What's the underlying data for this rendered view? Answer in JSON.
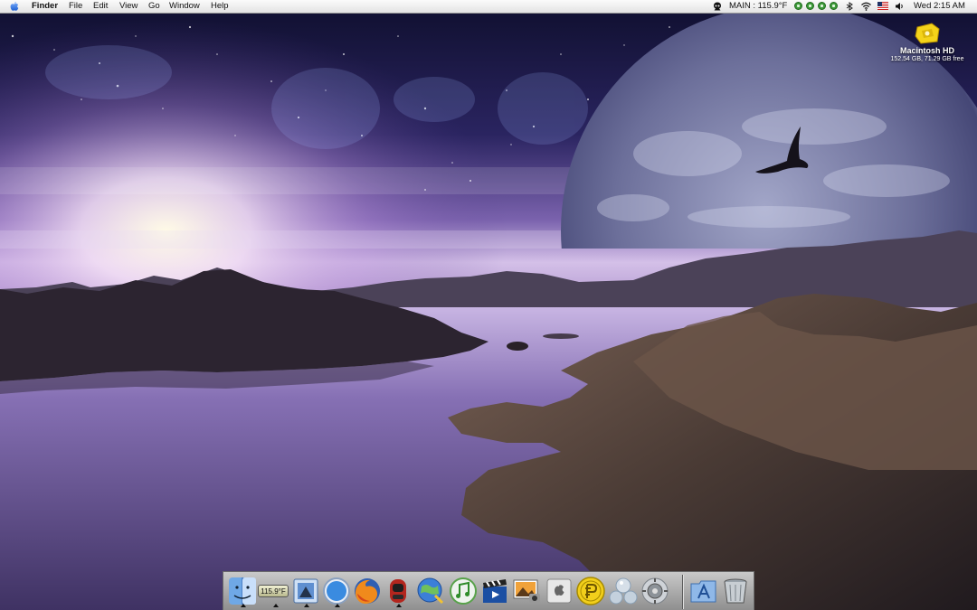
{
  "menubar": {
    "app_name": "Finder",
    "menus": [
      "File",
      "Edit",
      "View",
      "Go",
      "Window",
      "Help"
    ],
    "status": {
      "volume_temp": "MAIN : 115.9°F",
      "clock": "Wed 2:15 AM"
    },
    "icons": [
      "apple-icon",
      "alien-icon",
      "rewind-icon",
      "play-icon",
      "forward-icon",
      "stop-icon",
      "bluetooth-icon",
      "wifi-icon",
      "us-flag-icon",
      "speaker-icon"
    ]
  },
  "desktop": {
    "disk": {
      "name": "Macintosh HD",
      "info": "152.54 GB, 71.29 GB free"
    }
  },
  "dock": {
    "weather_temp": "115.9°F",
    "items": [
      {
        "name": "finder",
        "running": true
      },
      {
        "name": "temperature-monitor",
        "running": true
      },
      {
        "name": "mail",
        "running": true
      },
      {
        "name": "safari",
        "running": true
      },
      {
        "name": "firefox",
        "running": false
      },
      {
        "name": "vlc-like-player",
        "running": true
      },
      {
        "name": "network-utility",
        "running": false
      },
      {
        "name": "itunes",
        "running": false
      },
      {
        "name": "imovie",
        "running": false
      },
      {
        "name": "iphoto",
        "running": false
      },
      {
        "name": "apple-utility",
        "running": false
      },
      {
        "name": "coin-app",
        "running": false
      },
      {
        "name": "bubbles-app",
        "running": false
      },
      {
        "name": "system-preferences",
        "running": false
      },
      {
        "name": "applications-folder",
        "running": false
      },
      {
        "name": "trash",
        "running": false
      }
    ]
  },
  "colors": {
    "sky_top": "#15153a",
    "sky_glow": "#e6d6f4",
    "water": "#6a5a9a",
    "mountains": "#2e2630",
    "planet": "#8e8fb8"
  }
}
